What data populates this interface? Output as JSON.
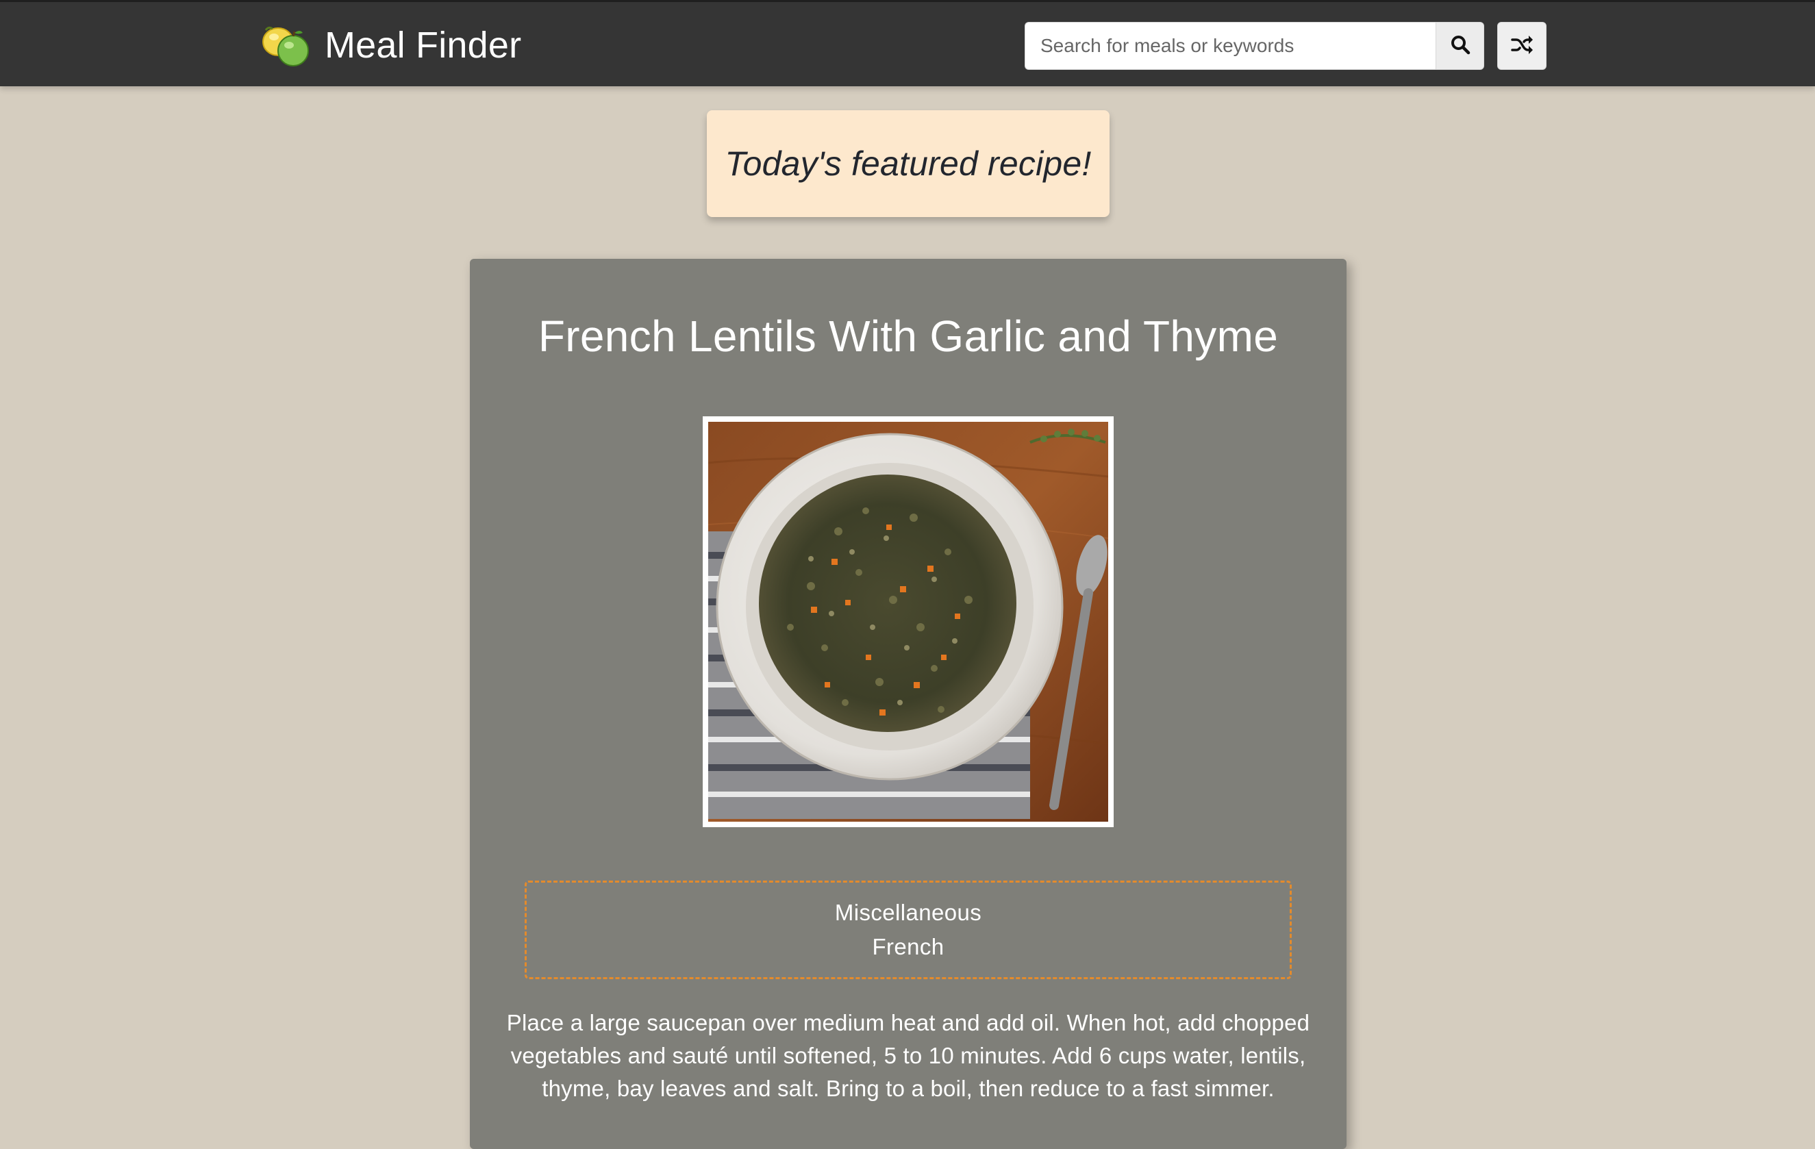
{
  "header": {
    "brand_title": "Meal Finder",
    "logo_icon": "fruit-icon",
    "search": {
      "placeholder": "Search for meals or keywords",
      "value": "",
      "button_icon": "search-icon"
    },
    "random_button_icon": "shuffle-icon"
  },
  "featured": {
    "label": "Today's featured recipe!"
  },
  "meal": {
    "title": "French Lentils With Garlic and Thyme",
    "photo_icon": "meal-photo",
    "tags": [
      "Miscellaneous",
      "French"
    ],
    "instructions": "Place a large saucepan over medium heat and add oil. When hot, add chopped vegetables and sauté until softened, 5 to 10 minutes. Add 6 cups water, lentils, thyme, bay leaves and salt. Bring to a boil, then reduce to a fast simmer."
  },
  "colors": {
    "header_bg": "#353535",
    "page_bg": "#d5cdbf",
    "featured_bg": "#fde8cd",
    "card_bg": "#7f7f79",
    "tags_border": "#e48b2c"
  }
}
